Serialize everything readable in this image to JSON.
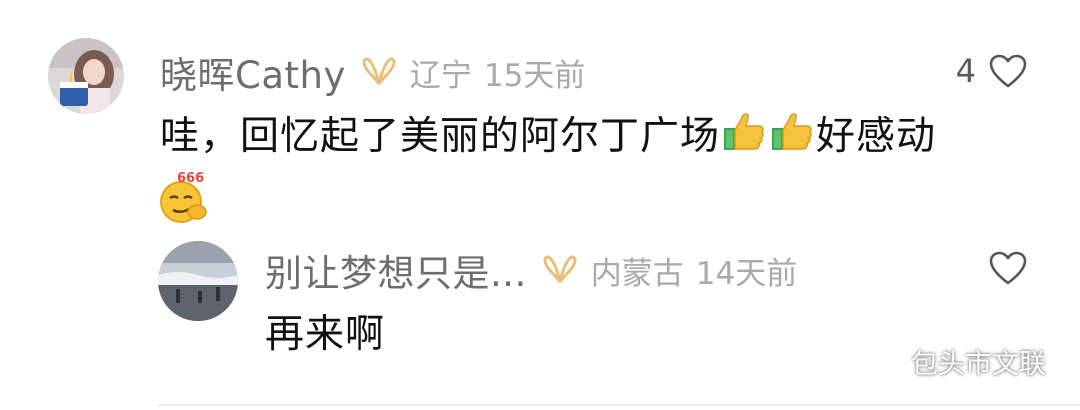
{
  "comment": {
    "user": {
      "nickname": "晓晖Cathy",
      "location": "辽宁",
      "time": "15天前"
    },
    "likes": "4",
    "text_parts": {
      "a": "哇，回忆起了美丽的阿尔丁广场",
      "b": "好感动"
    },
    "emojis": [
      "thumbs-up-icon",
      "thumbs-up-icon",
      "666-emoji-icon"
    ]
  },
  "reply": {
    "user": {
      "nickname": "别让梦想只是...",
      "location": "内蒙古",
      "time": "14天前"
    },
    "text": "再来啊"
  },
  "watermark": {
    "text": "包头市文联"
  },
  "colors": {
    "nickname": "#6d6d6d",
    "meta": "#a9a9a9",
    "text": "#111111",
    "badge": "#e8c07a",
    "divider": "#ededed"
  }
}
